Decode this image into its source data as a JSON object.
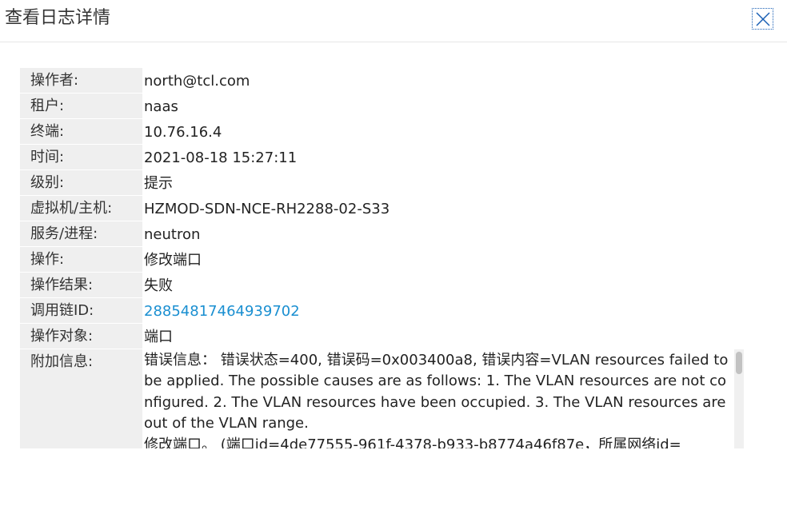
{
  "dialog": {
    "title": "查看日志详情",
    "close_icon": "close-icon"
  },
  "details": {
    "operator_label": "操作者:",
    "operator": "north@tcl.com",
    "tenant_label": "租户:",
    "tenant": "naas",
    "terminal_label": "终端:",
    "terminal": "10.76.16.4",
    "time_label": "时间:",
    "time": "2021-08-18 15:27:11",
    "level_label": "级别:",
    "level": "提示",
    "host_label": "虚拟机/主机:",
    "host": "HZMOD-SDN-NCE-RH2288-02-S33",
    "service_label": "服务/进程:",
    "service": "neutron",
    "operation_label": "操作:",
    "operation": "修改端口",
    "result_label": "操作结果:",
    "result": "失败",
    "trace_label": "调用链ID:",
    "trace_id": "28854817464939702",
    "object_label": "操作对象:",
    "object": "端口",
    "extra_label": "附加信息:",
    "extra": "错误信息： 错误状态=400, 错误码=0x003400a8, 错误内容=VLAN resources failed to be applied. The possible causes are as follows: 1. The VLAN resources are not configured. 2. The VLAN resources have been occupied. 3. The VLAN resources are out of the VLAN range.",
    "extra_line2": "修改端口。 (端口id=4de77555-961f-4378-b933-b8774a46f87e，所属网络id="
  },
  "colors": {
    "link": "#1a8fd1",
    "label_bg": "#efefef",
    "close_blue": "#1a5fb4"
  }
}
